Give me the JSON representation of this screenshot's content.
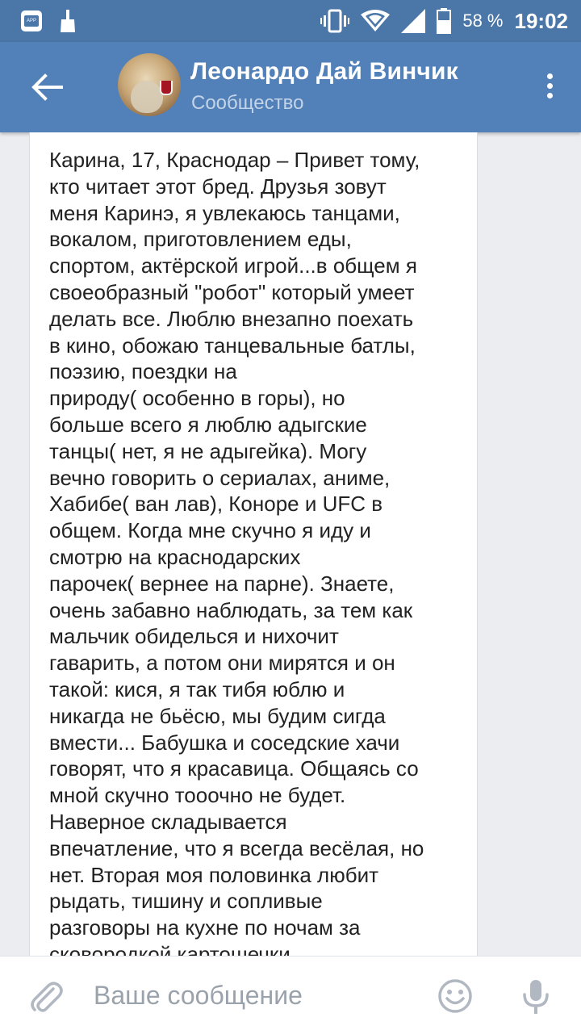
{
  "status_bar": {
    "battery_percent": "58 %",
    "time": "19:02",
    "app_icon_label": "APP"
  },
  "header": {
    "title": "Леонардо Дай Винчик",
    "subtitle": "Сообщество"
  },
  "message": {
    "text": "Карина, 17, Краснодар – Привет тому,\nкто читает этот бред. Друзья зовут\nменя Каринэ, я увлекаюсь танцами,\nвокалом, приготовлением еды,\nспортом, актёрской игрой...в общем я\nсвоеобразный \"робот\" который умеет\nделать все. Люблю внезапно поехать\nв кино, обожаю танцевальные батлы,\nпоэзию, поездки на\nприроду( особенно в горы), но\nбольше всего я люблю адыгские\nтанцы( нет, я не адыгейка). Могу\nвечно говорить о сериалах, аниме,\nХабибе( ван лав), Коноре и UFC в\nобщем. Когда мне скучно я иду и\nсмотрю на краснодарских\nпарочек( вернее на парне). Знаете,\nочень забавно наблюдать, за тем как\nмальчик обиделься и нихочит\nгаварить, а потом они мирятся и он\nтакой: кися, я так тибя юблю и\nникагда не бьёсю, мы будим сигда\nвмести... Бабушка и соседские хачи\nговорят, что я красавица. Общаясь со\nмной скучно тооочно не будет.\nНаверное  складывается\nвпечатление, что я всегда весёлая, но\nнет. Вторая моя половинка любит\nрыдать, тишину и сопливые\nразговоры на кухне по ночам за\nсковородкой картошечки"
  },
  "composer": {
    "placeholder": "Ваше сообщение"
  },
  "colors": {
    "statusbar": "#4a76a8",
    "header": "#5181b8",
    "background": "#ebedf0"
  }
}
